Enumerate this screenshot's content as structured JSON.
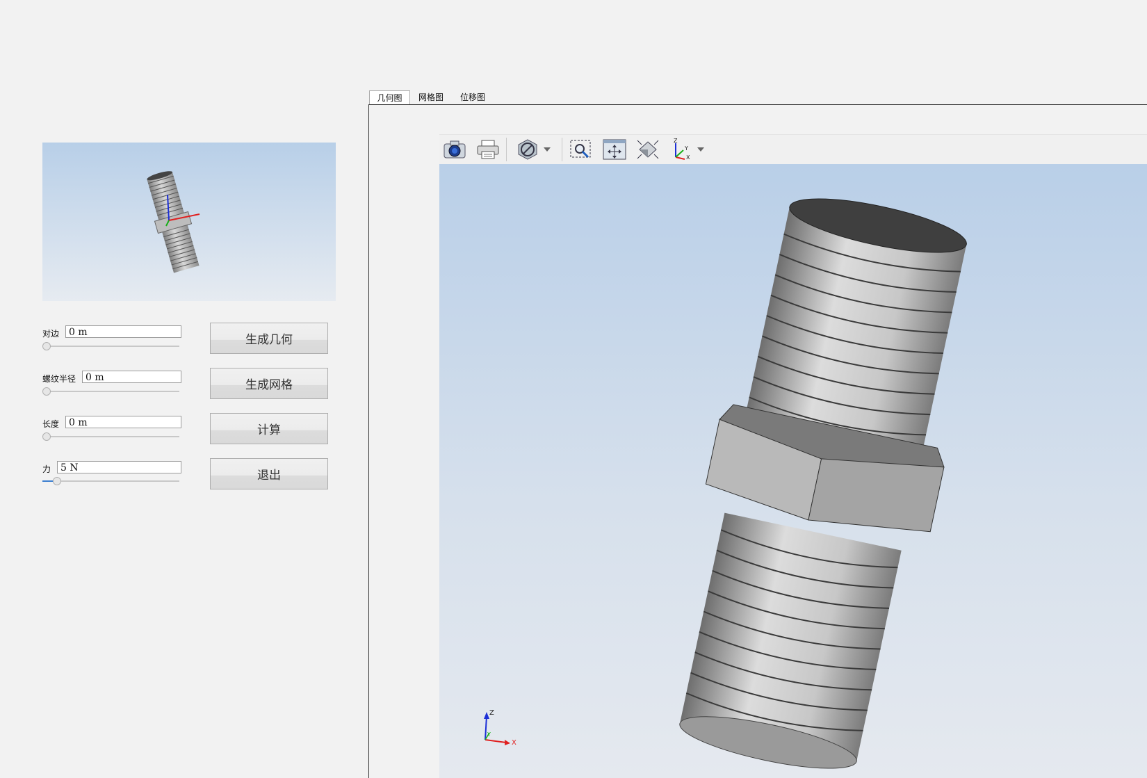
{
  "tabs": [
    {
      "label": "几何图",
      "active": true
    },
    {
      "label": "网格图",
      "active": false
    },
    {
      "label": "位移图",
      "active": false
    }
  ],
  "params": {
    "side": {
      "label": "对边",
      "value": "0 m",
      "slider": 0.0
    },
    "thread_radius": {
      "label": "螺纹半径",
      "value": "0 m",
      "slider": 0.0
    },
    "length": {
      "label": "长度",
      "value": "0 m",
      "slider": 0.0
    },
    "force": {
      "label": "力",
      "value": "5 N",
      "slider": 0.08
    }
  },
  "buttons": {
    "generate_geometry": "生成几何",
    "generate_mesh": "生成网格",
    "compute": "计算",
    "exit": "退出"
  },
  "toolbar": {
    "icons": [
      "camera-icon",
      "print-icon",
      "no-display-icon",
      "zoom-window-icon",
      "pan-fit-icon",
      "fit-all-icon",
      "axes-view-icon"
    ]
  },
  "triad": {
    "z": "Z",
    "y": "Y",
    "x": "X"
  },
  "colors": {
    "viewport_top": "#b9cfe8",
    "viewport_bottom": "#e5e9ef",
    "slider_accent": "#3c7fd0",
    "model": "#c4c4c4"
  }
}
